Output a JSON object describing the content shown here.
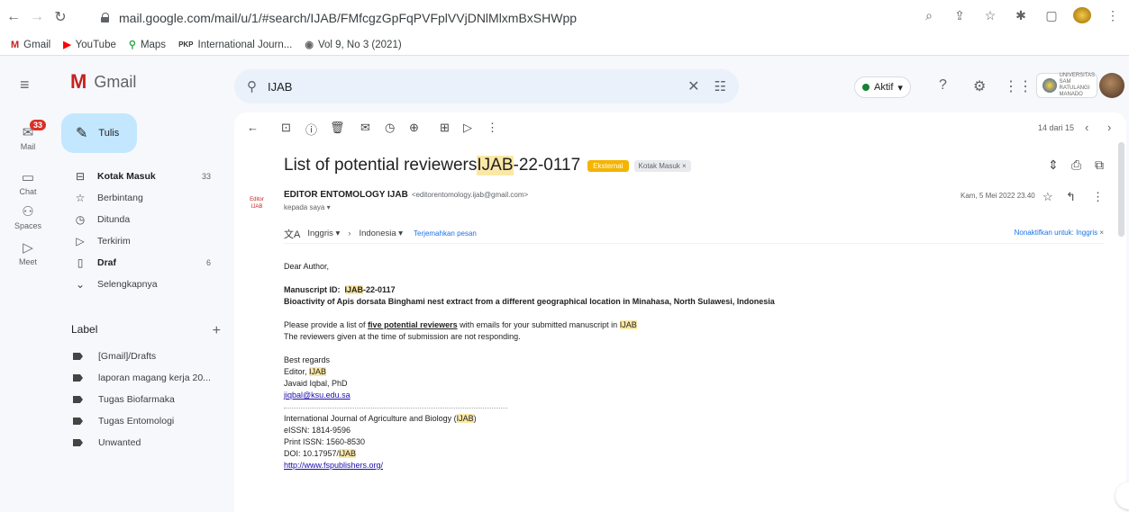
{
  "browser": {
    "url": "mail.google.com/mail/u/1/#search/IJAB/FMfcgzGpFqPVFplVVjDNlMlxmBxSHWpp",
    "bookmarks": [
      {
        "label": "Gmail"
      },
      {
        "label": "YouTube"
      },
      {
        "label": "Maps"
      },
      {
        "label": "International Journ..."
      },
      {
        "label": "Vol 9, No 3 (2021)"
      }
    ]
  },
  "rail": {
    "mail_badge": "33",
    "items": [
      {
        "label": "Mail"
      },
      {
        "label": "Chat"
      },
      {
        "label": "Spaces"
      },
      {
        "label": "Meet"
      }
    ]
  },
  "header": {
    "app_name": "Gmail",
    "search_value": "IJAB",
    "status": "Aktif",
    "org_badge_text": "UNIVERSITAS SAM RATULANGI MANADO"
  },
  "compose": {
    "label": "Tulis"
  },
  "nav": [
    {
      "label": "Kotak Masuk",
      "count": "33",
      "bold": true
    },
    {
      "label": "Berbintang",
      "count": ""
    },
    {
      "label": "Ditunda",
      "count": ""
    },
    {
      "label": "Terkirim",
      "count": ""
    },
    {
      "label": "Draf",
      "count": "6",
      "bold": true
    },
    {
      "label": "Selengkapnya",
      "count": ""
    }
  ],
  "labels": {
    "heading": "Label",
    "items": [
      "[Gmail]/Drafts",
      "laporan magang kerja 20...",
      "Tugas Biofarmaka",
      "Tugas Entomologi",
      "Unwanted"
    ]
  },
  "toolbar": {
    "pager": "14 dari 15"
  },
  "email": {
    "subject_pre": "List of potential reviewers ",
    "subject_hl": "IJAB",
    "subject_post": "-22-0117",
    "chip_external": "Eksternal",
    "chip_inbox": "Kotak Masuk ×",
    "avatar_text": "Editor IJAB",
    "sender_name": "EDITOR ENTOMOLOGY IJAB",
    "sender_email": "<editorentomology.ijab@gmail.com>",
    "to": "kepada saya ▾",
    "date": "Kam, 5 Mei 2022 23.40",
    "translate": {
      "from": "Inggris ▾",
      "to": "Indonesia ▾",
      "action": "Terjemahkan pesan",
      "off": "Nonaktifkan untuk: Inggris"
    },
    "body": {
      "greeting": "Dear Author,",
      "ms_label": "Manuscript ID:",
      "ms_id_hl": "IJAB",
      "ms_id_rest": "-22-0117",
      "title": "Bioactivity of Apis dorsata Binghami nest extract from a different geographical location in Minahasa, North Sulawesi, Indonesia",
      "line1_pre": "Please provide a list of ",
      "line1_ul": "five potential reviewers",
      "line1_mid": " with emails for your submitted manuscript in ",
      "line1_hl": "IJAB",
      "line2": "The reviewers given at the time of submission are not responding.",
      "regards": "Best regards",
      "editor_pre": "Editor, ",
      "editor_hl": "IJAB",
      "name": "Javaid Iqbal, PhD",
      "email_link": "jiqbal@ksu.edu.sa",
      "journal_pre": "International Journal of Agriculture and Biology (",
      "journal_hl": "IJAB",
      "journal_post": ")",
      "essn": "eISSN: 1814-9596",
      "pissn": "Print ISSN: 1560-8530",
      "doi_pre": "DOI: 10.17957/",
      "doi_hl": "IJAB",
      "website": "http://www.fspublishers.org/"
    }
  }
}
